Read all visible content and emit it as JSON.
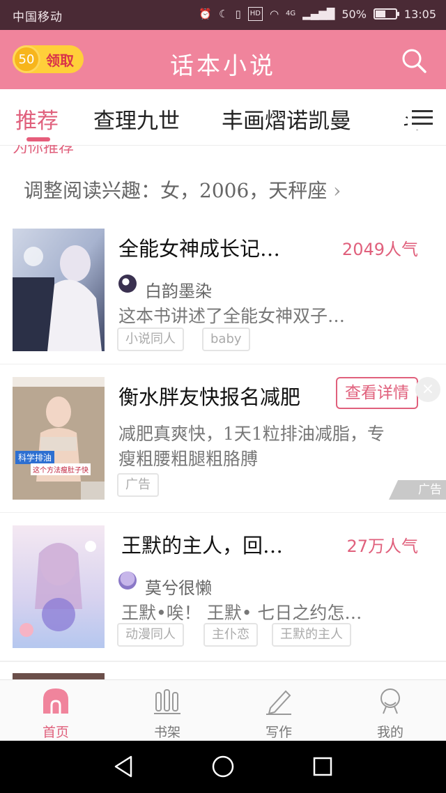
{
  "status_bar": {
    "carrier": "中国移动",
    "network": "4G",
    "battery": "50%",
    "battery_level": 0.5,
    "time": "13:05",
    "hd_label": "HD"
  },
  "header": {
    "title": "话本小说",
    "reward": {
      "coins": "50",
      "label": "领取"
    }
  },
  "tabs": [
    {
      "label": "推荐",
      "active": true
    },
    {
      "label": "查理九世",
      "active": false
    },
    {
      "label": "丰画熠诺凯曼",
      "active": false
    },
    {
      "label": "斗",
      "active": false
    }
  ],
  "section": {
    "heading_fragment": "为你推荐",
    "interest_text": "调整阅读兴趣：女，2006，天秤座",
    "interest_arrow": "›"
  },
  "books": [
    {
      "title": "全能女神成长记…",
      "popularity": "2049人气",
      "author": "白韵墨染",
      "description": "这本书讲述了全能女神双子…",
      "tags": [
        "小说同人",
        "baby"
      ]
    },
    {
      "title": "衡水胖友快报名减肥",
      "cta": "查看详情",
      "close": "×",
      "description_lines": [
        "减肥真爽快，1天1粒排油减脂，专",
        "瘦粗腰粗腿粗胳膊"
      ],
      "tags": [
        "广告"
      ],
      "ad_badge": "广告",
      "cover_text": [
        "科学排油",
        "这个方法瘦肚子快"
      ]
    },
    {
      "title": "王默的主人，回…",
      "popularity": "27万人气",
      "author": "莫兮很懒",
      "description": "王默•唉！ 王默• 七日之约怎…",
      "tags": [
        "动漫同人",
        "主仆恋",
        "王默的主人"
      ]
    }
  ],
  "bottom_nav": [
    {
      "label": "首页",
      "active": true
    },
    {
      "label": "书架",
      "active": false
    },
    {
      "label": "写作",
      "active": false
    },
    {
      "label": "我的",
      "active": false
    }
  ],
  "colors": {
    "accent": "#f0849c",
    "accent_text": "#e0607c",
    "status_bar": "#4a2a35"
  }
}
